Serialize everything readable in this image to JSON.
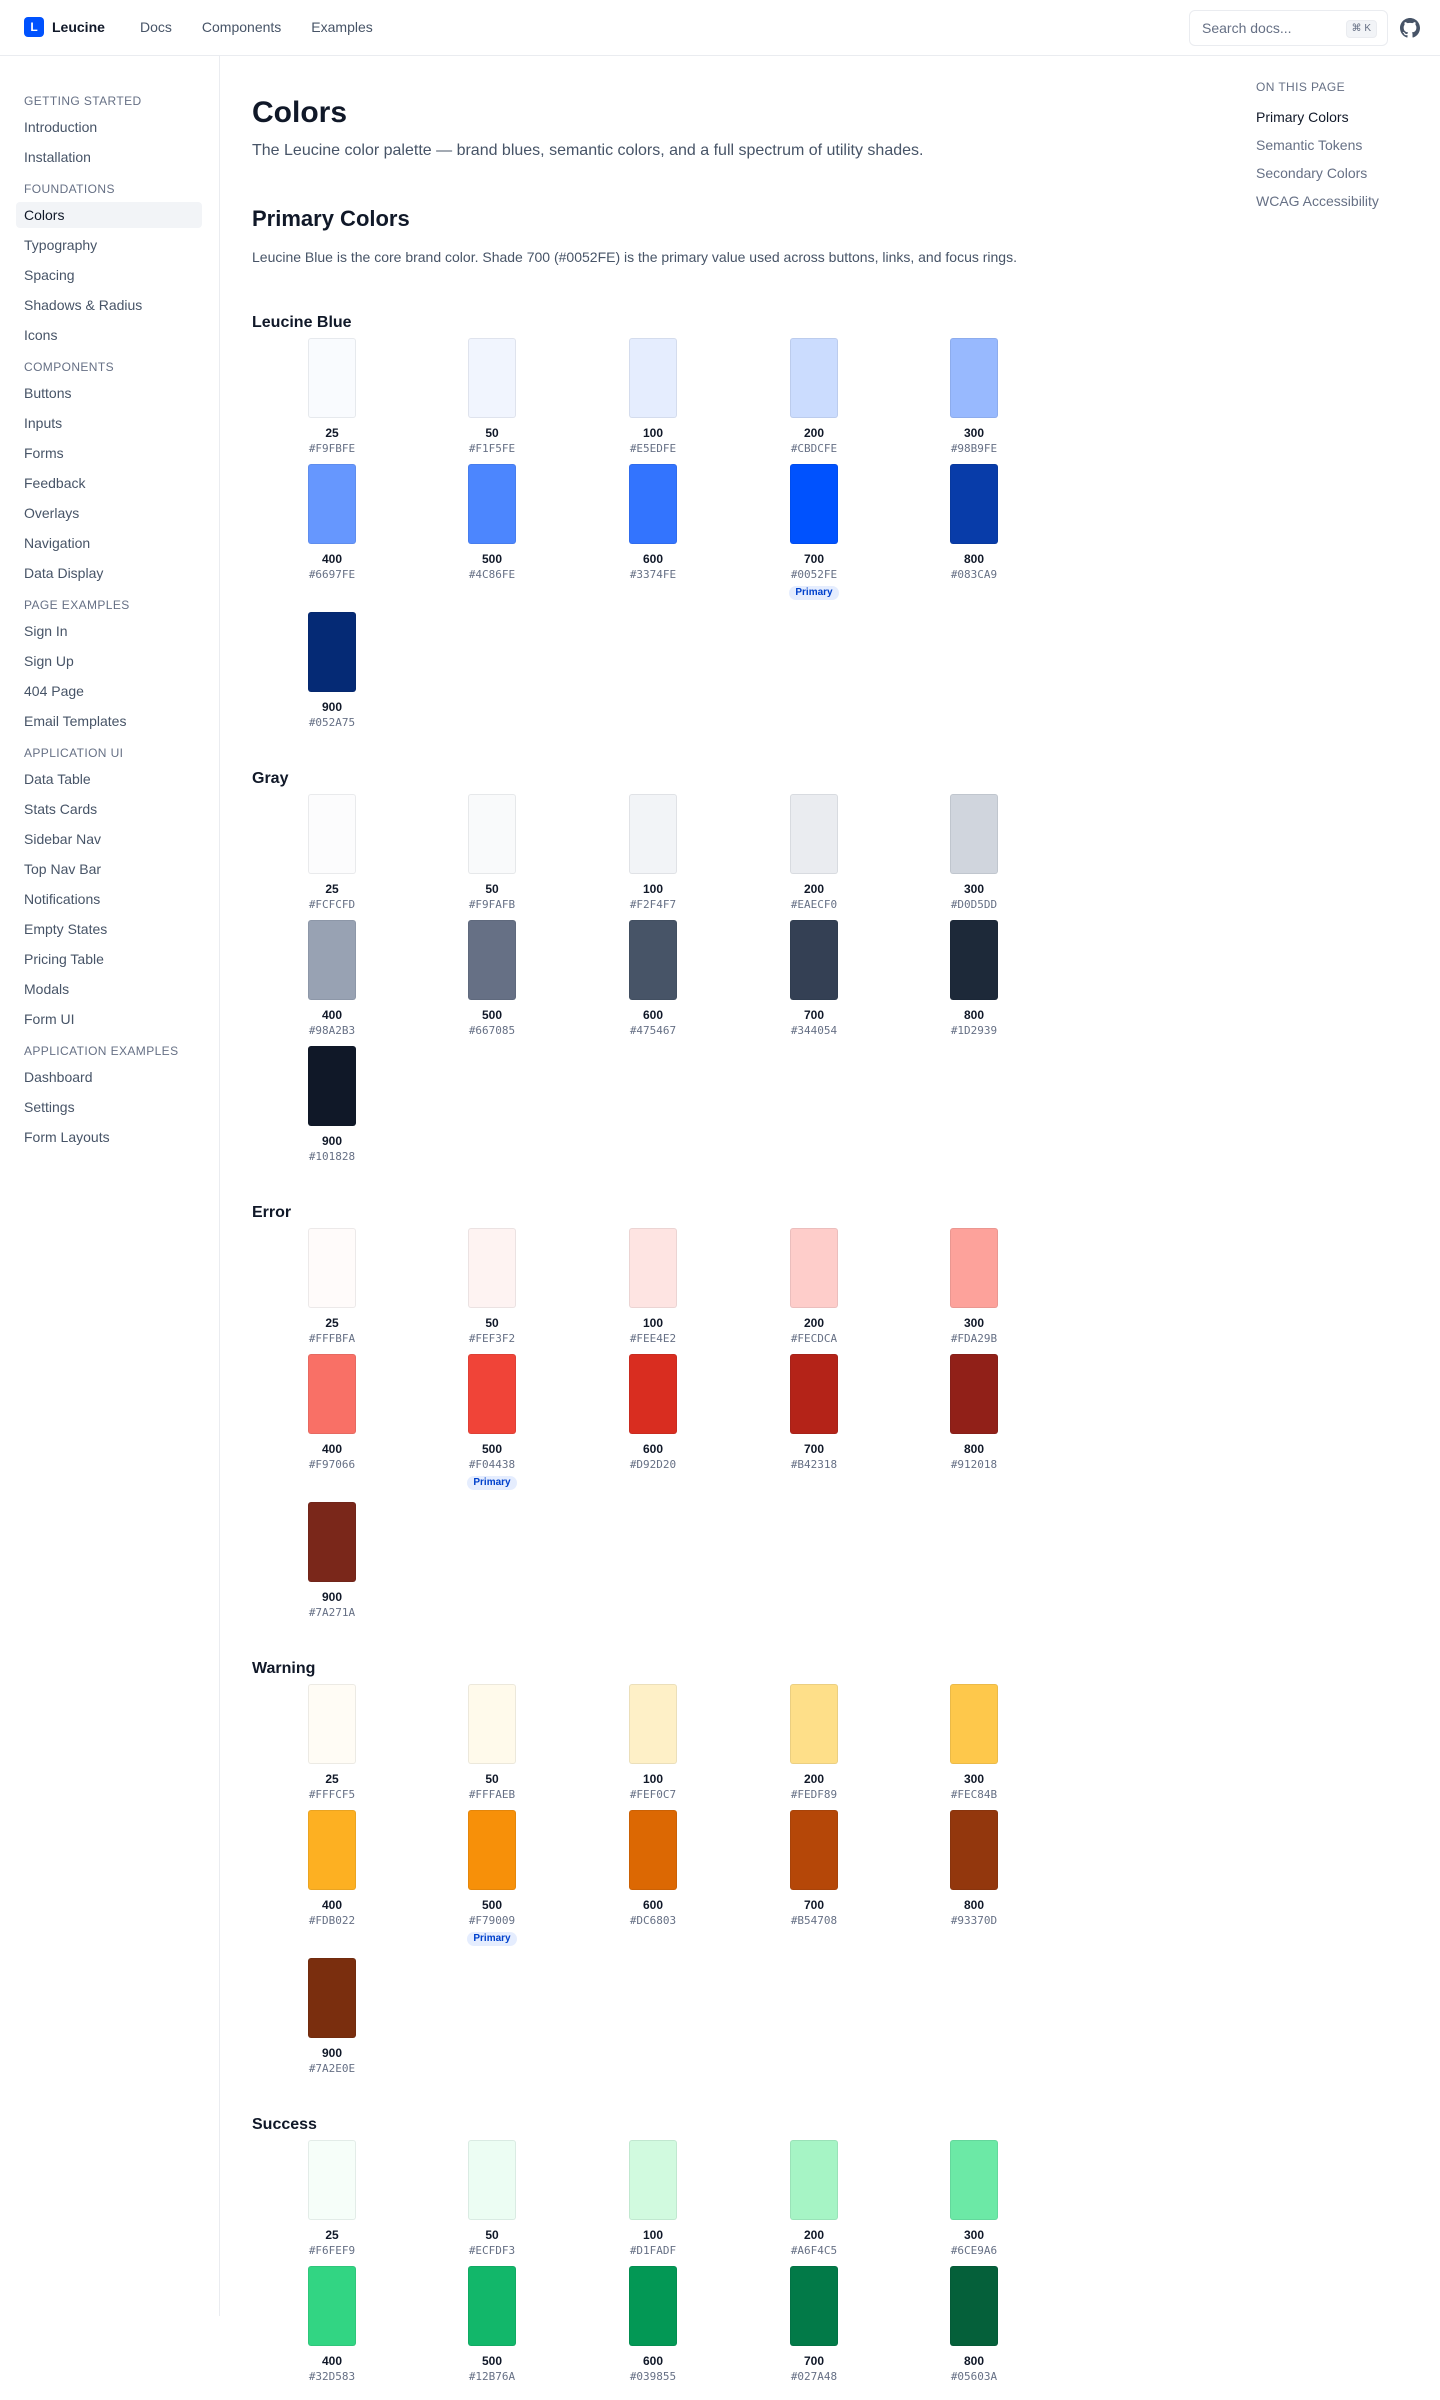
{
  "brand": {
    "name": "Leucine",
    "logo_letter": "L"
  },
  "topnav": [
    "Docs",
    "Components",
    "Examples"
  ],
  "search": {
    "placeholder": "Search docs...",
    "shortcut": "⌘ K"
  },
  "sidebar": {
    "sections": [
      {
        "title": "GETTING STARTED",
        "items": [
          "Introduction",
          "Installation"
        ]
      },
      {
        "title": "FOUNDATIONS",
        "items": [
          "Colors",
          "Typography",
          "Spacing",
          "Shadows & Radius",
          "Icons"
        ]
      },
      {
        "title": "COMPONENTS",
        "items": [
          "Buttons",
          "Inputs",
          "Forms",
          "Feedback",
          "Overlays",
          "Navigation",
          "Data Display"
        ]
      },
      {
        "title": "PAGE EXAMPLES",
        "items": [
          "Sign In",
          "Sign Up",
          "404 Page",
          "Email Templates"
        ]
      },
      {
        "title": "APPLICATION UI",
        "items": [
          "Data Table",
          "Stats Cards",
          "Sidebar Nav",
          "Top Nav Bar",
          "Notifications",
          "Empty States",
          "Pricing Table",
          "Modals",
          "Form UI"
        ]
      },
      {
        "title": "APPLICATION EXAMPLES",
        "items": [
          "Dashboard",
          "Settings",
          "Form Layouts"
        ]
      }
    ],
    "active": "Colors"
  },
  "page": {
    "title": "Colors",
    "subtitle": "The Leucine color palette — brand blues, semantic colors, and a full spectrum of utility shades.",
    "section_title": "Primary Colors",
    "section_desc": "Leucine Blue is the core brand color. Shade 700 (#0052FE) is the primary value used across buttons, links, and focus rings."
  },
  "badge_label": "Primary",
  "palettes": [
    {
      "name": "Leucine Blue",
      "primary": "700",
      "shades": [
        {
          "shade": "25",
          "hex": "#F9FBFE"
        },
        {
          "shade": "50",
          "hex": "#F1F5FE"
        },
        {
          "shade": "100",
          "hex": "#E5EDFE"
        },
        {
          "shade": "200",
          "hex": "#CBDCFE"
        },
        {
          "shade": "300",
          "hex": "#98B9FE"
        },
        {
          "shade": "400",
          "hex": "#6697FE"
        },
        {
          "shade": "500",
          "hex": "#4C86FE"
        },
        {
          "shade": "600",
          "hex": "#3374FE"
        },
        {
          "shade": "700",
          "hex": "#0052FE"
        },
        {
          "shade": "800",
          "hex": "#083CA9"
        },
        {
          "shade": "900",
          "hex": "#052A75"
        }
      ]
    },
    {
      "name": "Gray",
      "primary": "",
      "shades": [
        {
          "shade": "25",
          "hex": "#FCFCFD"
        },
        {
          "shade": "50",
          "hex": "#F9FAFB"
        },
        {
          "shade": "100",
          "hex": "#F2F4F7"
        },
        {
          "shade": "200",
          "hex": "#EAECF0"
        },
        {
          "shade": "300",
          "hex": "#D0D5DD"
        },
        {
          "shade": "400",
          "hex": "#98A2B3"
        },
        {
          "shade": "500",
          "hex": "#667085"
        },
        {
          "shade": "600",
          "hex": "#475467"
        },
        {
          "shade": "700",
          "hex": "#344054"
        },
        {
          "shade": "800",
          "hex": "#1D2939"
        },
        {
          "shade": "900",
          "hex": "#101828"
        }
      ]
    },
    {
      "name": "Error",
      "primary": "500",
      "shades": [
        {
          "shade": "25",
          "hex": "#FFFBFA"
        },
        {
          "shade": "50",
          "hex": "#FEF3F2"
        },
        {
          "shade": "100",
          "hex": "#FEE4E2"
        },
        {
          "shade": "200",
          "hex": "#FECDCA"
        },
        {
          "shade": "300",
          "hex": "#FDA29B"
        },
        {
          "shade": "400",
          "hex": "#F97066"
        },
        {
          "shade": "500",
          "hex": "#F04438"
        },
        {
          "shade": "600",
          "hex": "#D92D20"
        },
        {
          "shade": "700",
          "hex": "#B42318"
        },
        {
          "shade": "800",
          "hex": "#912018"
        },
        {
          "shade": "900",
          "hex": "#7A271A"
        }
      ]
    },
    {
      "name": "Warning",
      "primary": "500",
      "shades": [
        {
          "shade": "25",
          "hex": "#FFFCF5"
        },
        {
          "shade": "50",
          "hex": "#FFFAEB"
        },
        {
          "shade": "100",
          "hex": "#FEF0C7"
        },
        {
          "shade": "200",
          "hex": "#FEDF89"
        },
        {
          "shade": "300",
          "hex": "#FEC84B"
        },
        {
          "shade": "400",
          "hex": "#FDB022"
        },
        {
          "shade": "500",
          "hex": "#F79009"
        },
        {
          "shade": "600",
          "hex": "#DC6803"
        },
        {
          "shade": "700",
          "hex": "#B54708"
        },
        {
          "shade": "800",
          "hex": "#93370D"
        },
        {
          "shade": "900",
          "hex": "#7A2E0E"
        }
      ]
    },
    {
      "name": "Success",
      "primary": "",
      "shades": [
        {
          "shade": "25",
          "hex": "#F6FEF9"
        },
        {
          "shade": "50",
          "hex": "#ECFDF3"
        },
        {
          "shade": "100",
          "hex": "#D1FADF"
        },
        {
          "shade": "200",
          "hex": "#A6F4C5"
        },
        {
          "shade": "300",
          "hex": "#6CE9A6"
        },
        {
          "shade": "400",
          "hex": "#32D583"
        },
        {
          "shade": "500",
          "hex": "#12B76A"
        },
        {
          "shade": "600",
          "hex": "#039855"
        },
        {
          "shade": "700",
          "hex": "#027A48"
        },
        {
          "shade": "800",
          "hex": "#05603A"
        }
      ]
    }
  ],
  "toc": {
    "title": "ON THIS PAGE",
    "items": [
      "Primary Colors",
      "Semantic Tokens",
      "Secondary Colors",
      "WCAG Accessibility"
    ],
    "active": "Primary Colors"
  }
}
